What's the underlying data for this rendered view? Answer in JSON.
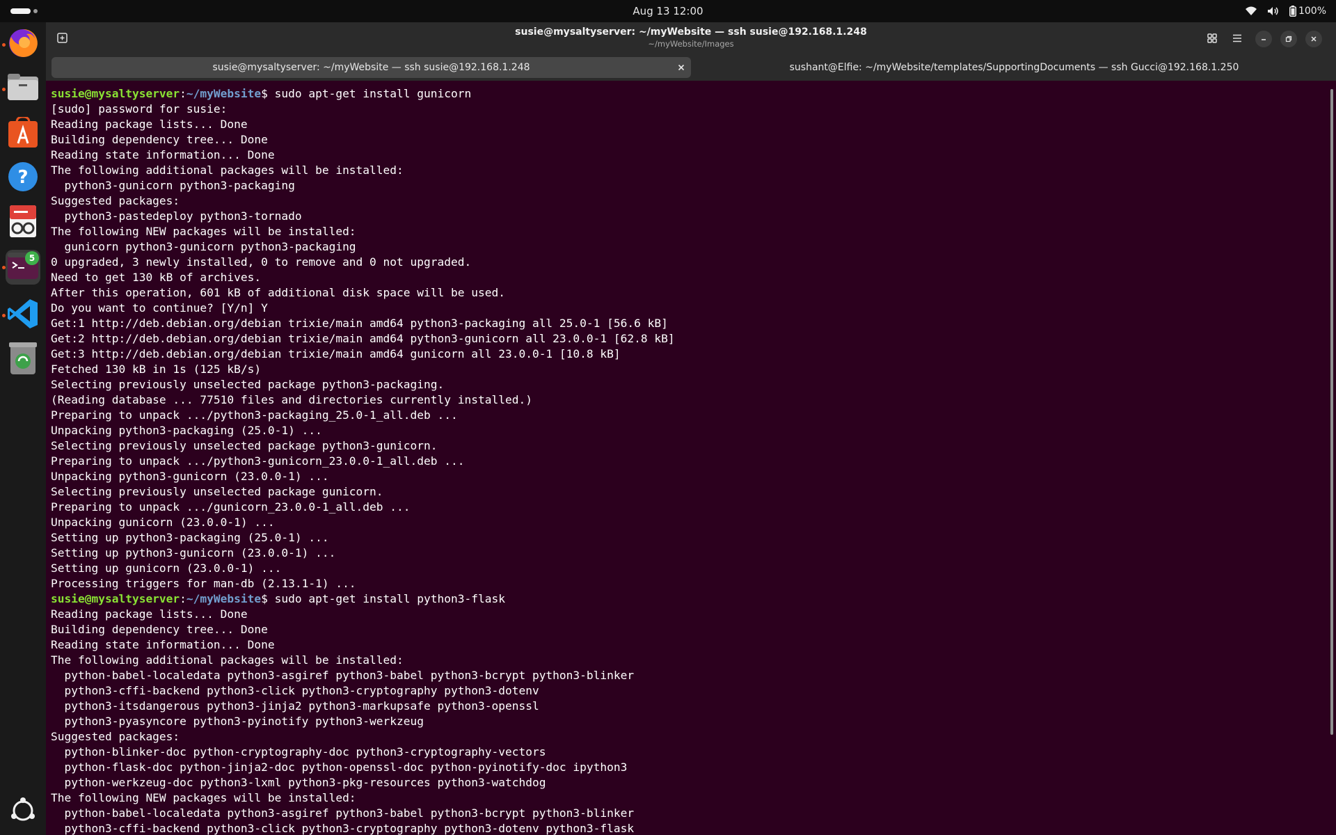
{
  "topbar": {
    "clock": "Aug 13  12:00",
    "battery": "100%",
    "icons": [
      "wifi-icon",
      "volume-icon",
      "battery-icon"
    ]
  },
  "dock": {
    "items": [
      {
        "name": "firefox",
        "running": true
      },
      {
        "name": "files",
        "running": true
      },
      {
        "name": "app-center",
        "running": false
      },
      {
        "name": "help",
        "running": false
      },
      {
        "name": "document-viewer",
        "running": false
      },
      {
        "name": "terminal",
        "running": true,
        "badge": "5",
        "active": true
      },
      {
        "name": "vscode",
        "running": true
      },
      {
        "name": "trash",
        "running": false
      },
      {
        "name": "ubuntu-apps",
        "running": false
      }
    ]
  },
  "window": {
    "title": "susie@mysaltyserver: ~/myWebsite — ssh susie@192.168.1.248",
    "subtitle": "~/myWebsite/Images",
    "tabs": [
      {
        "label": "susie@mysaltyserver: ~/myWebsite — ssh susie@192.168.1.248",
        "active": true
      },
      {
        "label": "sushant@Elfie: ~/myWebsite/templates/SupportingDocuments — ssh Gucci@192.168.1.250",
        "active": false
      }
    ]
  },
  "terminal": {
    "prompt_user": "susie@mysaltyserver",
    "prompt_sep": ":",
    "prompt_path": "~/myWebsite",
    "prompt_sym": "$ ",
    "lines": [
      {
        "cmd": "sudo apt-get install gunicorn"
      },
      {
        "text": "[sudo] password for susie:"
      },
      {
        "text": "Reading package lists... Done"
      },
      {
        "text": "Building dependency tree... Done"
      },
      {
        "text": "Reading state information... Done"
      },
      {
        "text": "The following additional packages will be installed:"
      },
      {
        "text": "  python3-gunicorn python3-packaging"
      },
      {
        "text": "Suggested packages:"
      },
      {
        "text": "  python3-pastedeploy python3-tornado"
      },
      {
        "text": "The following NEW packages will be installed:"
      },
      {
        "text": "  gunicorn python3-gunicorn python3-packaging"
      },
      {
        "text": "0 upgraded, 3 newly installed, 0 to remove and 0 not upgraded."
      },
      {
        "text": "Need to get 130 kB of archives."
      },
      {
        "text": "After this operation, 601 kB of additional disk space will be used."
      },
      {
        "text": "Do you want to continue? [Y/n] Y"
      },
      {
        "text": "Get:1 http://deb.debian.org/debian trixie/main amd64 python3-packaging all 25.0-1 [56.6 kB]"
      },
      {
        "text": "Get:2 http://deb.debian.org/debian trixie/main amd64 python3-gunicorn all 23.0.0-1 [62.8 kB]"
      },
      {
        "text": "Get:3 http://deb.debian.org/debian trixie/main amd64 gunicorn all 23.0.0-1 [10.8 kB]"
      },
      {
        "text": "Fetched 130 kB in 1s (125 kB/s)"
      },
      {
        "text": "Selecting previously unselected package python3-packaging."
      },
      {
        "text": "(Reading database ... 77510 files and directories currently installed.)"
      },
      {
        "text": "Preparing to unpack .../python3-packaging_25.0-1_all.deb ..."
      },
      {
        "text": "Unpacking python3-packaging (25.0-1) ..."
      },
      {
        "text": "Selecting previously unselected package python3-gunicorn."
      },
      {
        "text": "Preparing to unpack .../python3-gunicorn_23.0.0-1_all.deb ..."
      },
      {
        "text": "Unpacking python3-gunicorn (23.0.0-1) ..."
      },
      {
        "text": "Selecting previously unselected package gunicorn."
      },
      {
        "text": "Preparing to unpack .../gunicorn_23.0.0-1_all.deb ..."
      },
      {
        "text": "Unpacking gunicorn (23.0.0-1) ..."
      },
      {
        "text": "Setting up python3-packaging (25.0-1) ..."
      },
      {
        "text": "Setting up python3-gunicorn (23.0.0-1) ..."
      },
      {
        "text": "Setting up gunicorn (23.0.0-1) ..."
      },
      {
        "text": "Processing triggers for man-db (2.13.1-1) ..."
      },
      {
        "cmd": "sudo apt-get install python3-flask"
      },
      {
        "text": "Reading package lists... Done"
      },
      {
        "text": "Building dependency tree... Done"
      },
      {
        "text": "Reading state information... Done"
      },
      {
        "text": "The following additional packages will be installed:"
      },
      {
        "text": "  python-babel-localedata python3-asgiref python3-babel python3-bcrypt python3-blinker"
      },
      {
        "text": "  python3-cffi-backend python3-click python3-cryptography python3-dotenv"
      },
      {
        "text": "  python3-itsdangerous python3-jinja2 python3-markupsafe python3-openssl"
      },
      {
        "text": "  python3-pyasyncore python3-pyinotify python3-werkzeug"
      },
      {
        "text": "Suggested packages:"
      },
      {
        "text": "  python-blinker-doc python-cryptography-doc python3-cryptography-vectors"
      },
      {
        "text": "  python-flask-doc python-jinja2-doc python-openssl-doc python-pyinotify-doc ipython3"
      },
      {
        "text": "  python-werkzeug-doc python3-lxml python3-pkg-resources python3-watchdog"
      },
      {
        "text": "The following NEW packages will be installed:"
      },
      {
        "text": "  python-babel-localedata python3-asgiref python3-babel python3-bcrypt python3-blinker"
      },
      {
        "text": "  python3-cffi-backend python3-click python3-cryptography python3-dotenv python3-flask"
      }
    ]
  }
}
